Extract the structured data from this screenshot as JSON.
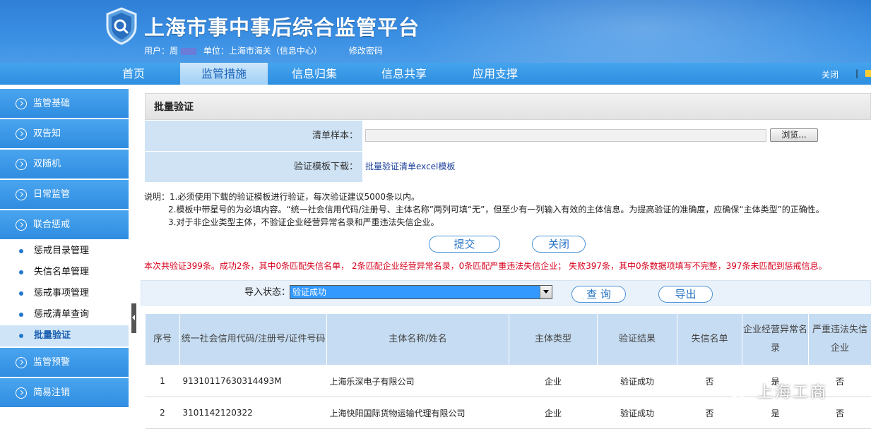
{
  "header": {
    "title": "上海市事中事后综合监管平台",
    "user_label": "用户：周",
    "unit_label": "单位：上海市海关（信息中心）",
    "change_password": "修改密码"
  },
  "nav": {
    "items": [
      "首页",
      "监管措施",
      "信息归集",
      "信息共享",
      "应用支撑"
    ],
    "active": "监管措施",
    "close": "关闭",
    "separator": "|"
  },
  "sidebar": {
    "sections_top": [
      "监管基础",
      "双告知",
      "双随机",
      "日常监管",
      "联合惩戒"
    ],
    "sub_items": [
      "惩戒目录管理",
      "失信名单管理",
      "惩戒事项管理",
      "惩戒清单查询",
      "批量验证"
    ],
    "active_sub": "批量验证",
    "sections_bottom": [
      "监管预警",
      "简易注销"
    ]
  },
  "panel": {
    "title": "批量验证",
    "sample_label": "清单样本：",
    "browse_label": "浏览...",
    "template_label": "验证模板下载：",
    "template_link": "批量验证清单excel模板"
  },
  "notes": {
    "line1": "说明：1.必须使用下载的验证模板进行验证，每次验证建议5000条以内。",
    "line2": "2.模板中带星号的为必填内容。“统一社会信用代码/注册号、主体名称”两列可填“无”，但至少有一列输入有效的主体信息。为提高验证的准确度，应确保“主体类型”的正确性。",
    "line3": "3.对于非企业类型主体，不验证企业经营异常名录和严重违法失信企业。"
  },
  "buttons": {
    "submit": "提交",
    "close": "关闭",
    "query": "查 询",
    "export": "导出"
  },
  "result_text": "本次共验证399条。成功2条，其中0条匹配失信名单， 2条匹配企业经营异常名录，0条匹配严重违法失信企业； 失败397条，其中0条数据项填写不完整，397条未匹配到惩戒信息。",
  "filter": {
    "label": "导入状态：",
    "selected": "验证成功"
  },
  "table": {
    "headers": [
      "序号",
      "统一社会信用代码/注册号/证件号码",
      "主体名称/姓名",
      "主体类型",
      "验证结果",
      "失信名单",
      "企业经营异常名录",
      "严重违法失信企业"
    ],
    "rows": [
      [
        "1",
        "91310117630314493M",
        "上海乐深电子有限公司",
        "企业",
        "验证成功",
        "否",
        "是",
        "否"
      ],
      [
        "2",
        "3101142120322",
        "上海快阳国际货物运输代理有限公司",
        "企业",
        "验证成功",
        "否",
        "是",
        "否"
      ]
    ]
  },
  "watermark": "上海工商",
  "colors": {
    "header_blue": "#3b90e4",
    "sidebar_blue": "#2f8ce0",
    "label_bg": "#cfe3f5",
    "table_header_bg": "#c6dcf2",
    "result_red": "#d6001c",
    "select_blue": "#3399ff"
  }
}
